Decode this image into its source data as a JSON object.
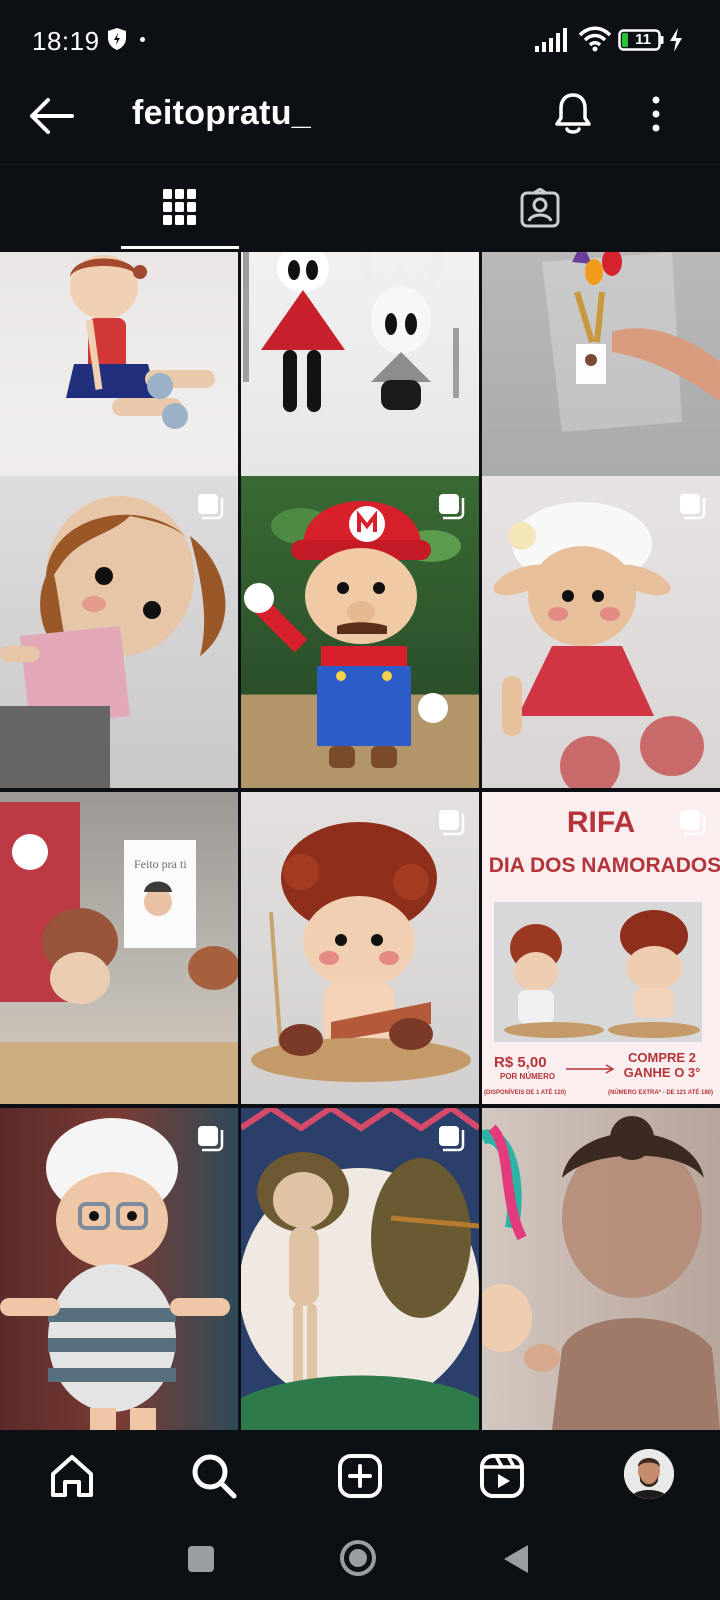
{
  "status_bar": {
    "time": "18:19",
    "battery": "11"
  },
  "header": {
    "username": "feitopratu_"
  },
  "tabs": [
    {
      "icon": "grid-icon",
      "selected": true
    },
    {
      "icon": "tagged-icon",
      "selected": false
    }
  ],
  "posts": [
    {
      "subject": "doll in red top and blue skirt",
      "multi": false
    },
    {
      "subject": "two crochet knight figures",
      "multi": false
    },
    {
      "subject": "gift bouquet with tulips",
      "multi": false
    },
    {
      "subject": "brown-haired doll in pink",
      "multi": true
    },
    {
      "subject": "mario plush",
      "multi": true
    },
    {
      "subject": "sheep doll in red dress",
      "multi": true
    },
    {
      "subject": "gift packages with card",
      "multi": false,
      "card_text": "Feito pra ti"
    },
    {
      "subject": "curly cupid doll",
      "multi": true
    },
    {
      "subject": "raffle flyer",
      "multi": true,
      "flyer": {
        "title": "RIFA",
        "subtitle": "DIA DOS NAMORADOS",
        "price": "R$ 5,00",
        "per_number": "POR NÚMERO",
        "offer": "COMPRE 2 GANHE O 3°",
        "left_note": "(DISPONÍVEIS DE 1 ATÉ 120)",
        "right_note": "(NÚMERO EXTRA* - DE 121 ATÉ 180)"
      }
    },
    {
      "subject": "grandma doll with glasses",
      "multi": true
    },
    {
      "subject": "doll body on hoop",
      "multi": true
    },
    {
      "subject": "smiling woman portrait",
      "multi": false
    }
  ],
  "bottom_nav": [
    "home-icon",
    "search-icon",
    "create-icon",
    "reels-icon",
    "profile-avatar"
  ],
  "colors": {
    "background": "#0c1014",
    "text": "#ffffff",
    "flyer_red": "#b5343a"
  }
}
